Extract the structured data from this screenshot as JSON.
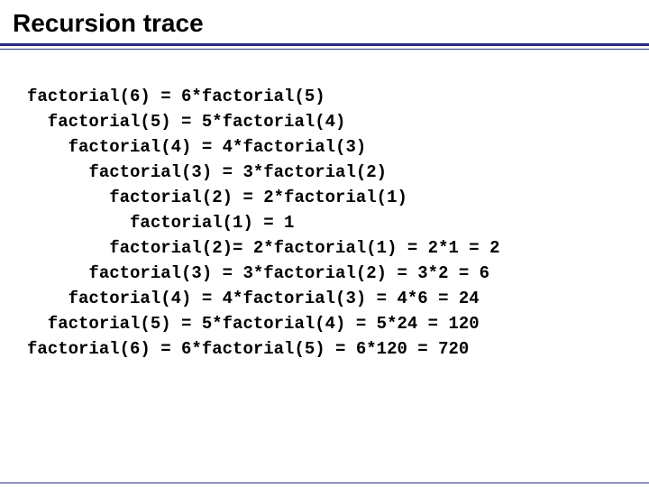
{
  "title": "Recursion trace",
  "trace": [
    {
      "indent": 0,
      "text": "factorial(6) = 6*factorial(5)"
    },
    {
      "indent": 1,
      "text": "factorial(5) = 5*factorial(4)"
    },
    {
      "indent": 2,
      "text": "factorial(4) = 4*factorial(3)"
    },
    {
      "indent": 3,
      "text": "factorial(3) = 3*factorial(2)"
    },
    {
      "indent": 4,
      "text": "factorial(2) = 2*factorial(1)"
    },
    {
      "indent": 5,
      "text": "factorial(1) = 1"
    },
    {
      "indent": 4,
      "text": "factorial(2)= 2*factorial(1) = 2*1 = 2"
    },
    {
      "indent": 3,
      "text": "factorial(3) = 3*factorial(2) = 3*2 = 6"
    },
    {
      "indent": 2,
      "text": "factorial(4) = 4*factorial(3) = 4*6 = 24"
    },
    {
      "indent": 1,
      "text": "factorial(5) = 5*factorial(4) = 5*24 = 120"
    },
    {
      "indent": 0,
      "text": "factorial(6) = 6*factorial(5) = 6*120 = 720"
    }
  ]
}
